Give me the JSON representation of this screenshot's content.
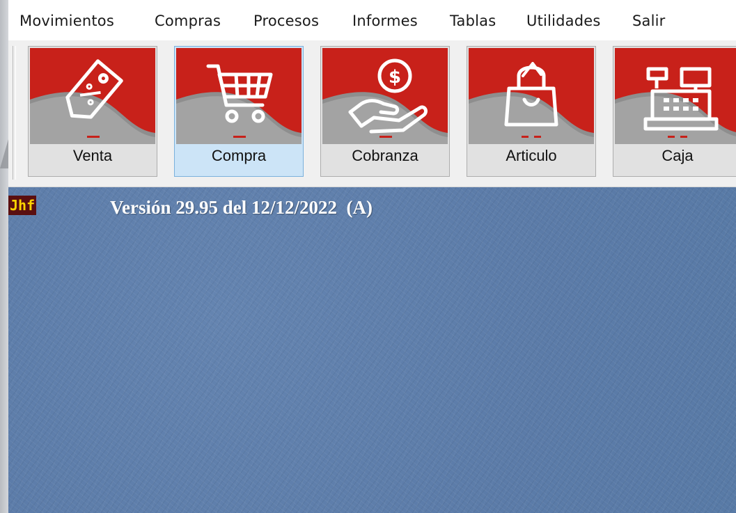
{
  "menu": {
    "items": [
      {
        "label": "Movimientos"
      },
      {
        "label": "Compras"
      },
      {
        "label": "Procesos"
      },
      {
        "label": "Informes"
      },
      {
        "label": "Tablas"
      },
      {
        "label": "Utilidades"
      },
      {
        "label": "Salir"
      }
    ]
  },
  "toolbar": {
    "buttons": [
      {
        "label": "Venta",
        "icon": "price-tag-icon",
        "selected": false
      },
      {
        "label": "Compra",
        "icon": "shopping-cart-icon",
        "selected": true
      },
      {
        "label": "Cobranza",
        "icon": "hand-coin-icon",
        "selected": false
      },
      {
        "label": "Articulo",
        "icon": "shopping-bag-icon",
        "selected": false
      },
      {
        "label": "Caja",
        "icon": "cash-register-icon",
        "selected": false
      }
    ]
  },
  "desktop": {
    "logo_text": "Jhf",
    "version_text": "Versión 29.95 del 12/12/2022  (A)"
  },
  "colors": {
    "button_red": "#c8211a",
    "desktop_blue": "#5f7fac",
    "selected_button": "#cce4f7",
    "logo_bg": "#5a0f10",
    "logo_fg": "#ffd400"
  }
}
